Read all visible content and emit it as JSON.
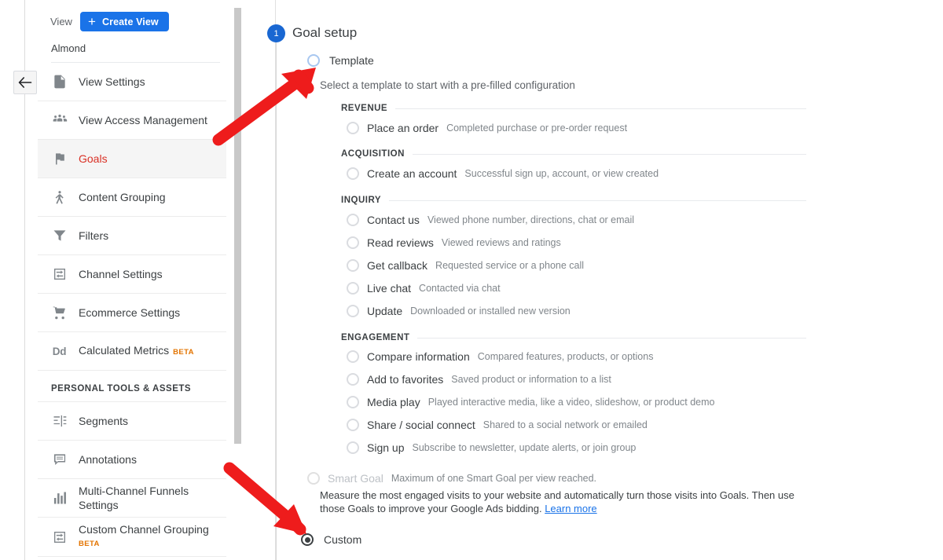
{
  "sidebar": {
    "view_label": "View",
    "create_view_button": "Create View",
    "account_name": "Almond",
    "items": [
      {
        "label": "View Settings",
        "icon": "document-icon",
        "active": false,
        "beta": ""
      },
      {
        "label": "View Access Management",
        "icon": "people-icon",
        "active": false,
        "beta": ""
      },
      {
        "label": "Goals",
        "icon": "flag-icon",
        "active": true,
        "beta": ""
      },
      {
        "label": "Content Grouping",
        "icon": "content-grouping-icon",
        "active": false,
        "beta": ""
      },
      {
        "label": "Filters",
        "icon": "funnel-icon",
        "active": false,
        "beta": ""
      },
      {
        "label": "Channel Settings",
        "icon": "channel-settings-icon",
        "active": false,
        "beta": ""
      },
      {
        "label": "Ecommerce Settings",
        "icon": "cart-icon",
        "active": false,
        "beta": ""
      },
      {
        "label": "Calculated Metrics",
        "icon": "dd-icon",
        "active": false,
        "beta": "BETA"
      }
    ],
    "section_header": "PERSONAL TOOLS & ASSETS",
    "tools": [
      {
        "label": "Segments",
        "icon": "segments-icon",
        "beta": ""
      },
      {
        "label": "Annotations",
        "icon": "annotation-icon",
        "beta": ""
      },
      {
        "label": "Multi-Channel Funnels Settings",
        "icon": "bar-chart-icon",
        "beta": ""
      },
      {
        "label": "Custom Channel Grouping",
        "icon": "channel-settings-icon",
        "beta": "BETA"
      }
    ],
    "back_icon": "back-arrow-icon"
  },
  "main": {
    "step_number": "1",
    "title": "Goal setup",
    "template_option": "Template",
    "template_subtitle": "Select a template to start with a pre-filled configuration",
    "groups": [
      {
        "name": "REVENUE",
        "options": [
          {
            "title": "Place an order",
            "desc": "Completed purchase or pre-order request"
          }
        ]
      },
      {
        "name": "ACQUISITION",
        "options": [
          {
            "title": "Create an account",
            "desc": "Successful sign up, account, or view created"
          }
        ]
      },
      {
        "name": "INQUIRY",
        "options": [
          {
            "title": "Contact us",
            "desc": "Viewed phone number, directions, chat or email"
          },
          {
            "title": "Read reviews",
            "desc": "Viewed reviews and ratings"
          },
          {
            "title": "Get callback",
            "desc": "Requested service or a phone call"
          },
          {
            "title": "Live chat",
            "desc": "Contacted via chat"
          },
          {
            "title": "Update",
            "desc": "Downloaded or installed new version"
          }
        ]
      },
      {
        "name": "ENGAGEMENT",
        "options": [
          {
            "title": "Compare information",
            "desc": "Compared features, products, or options"
          },
          {
            "title": "Add to favorites",
            "desc": "Saved product or information to a list"
          },
          {
            "title": "Media play",
            "desc": "Played interactive media, like a video, slideshow, or product demo"
          },
          {
            "title": "Share / social connect",
            "desc": "Shared to a social network or emailed"
          },
          {
            "title": "Sign up",
            "desc": "Subscribe to newsletter, update alerts, or join group"
          }
        ]
      }
    ],
    "smart_goal": {
      "title": "Smart Goal",
      "note": "Maximum of one Smart Goal per view reached.",
      "description": "Measure the most engaged visits to your website and automatically turn those visits into Goals. Then use those Goals to improve your Google Ads bidding.",
      "link": "Learn more"
    },
    "custom_option": "Custom"
  },
  "annotations": {
    "arrow_color": "#ee1c1c",
    "arrow_up_target": "template-radio",
    "arrow_down_target": "custom-radio"
  },
  "colors": {
    "accent_blue": "#1a73e8",
    "active_red": "#d93025",
    "beta_orange": "#e37400",
    "link_blue": "#1a73e8"
  }
}
